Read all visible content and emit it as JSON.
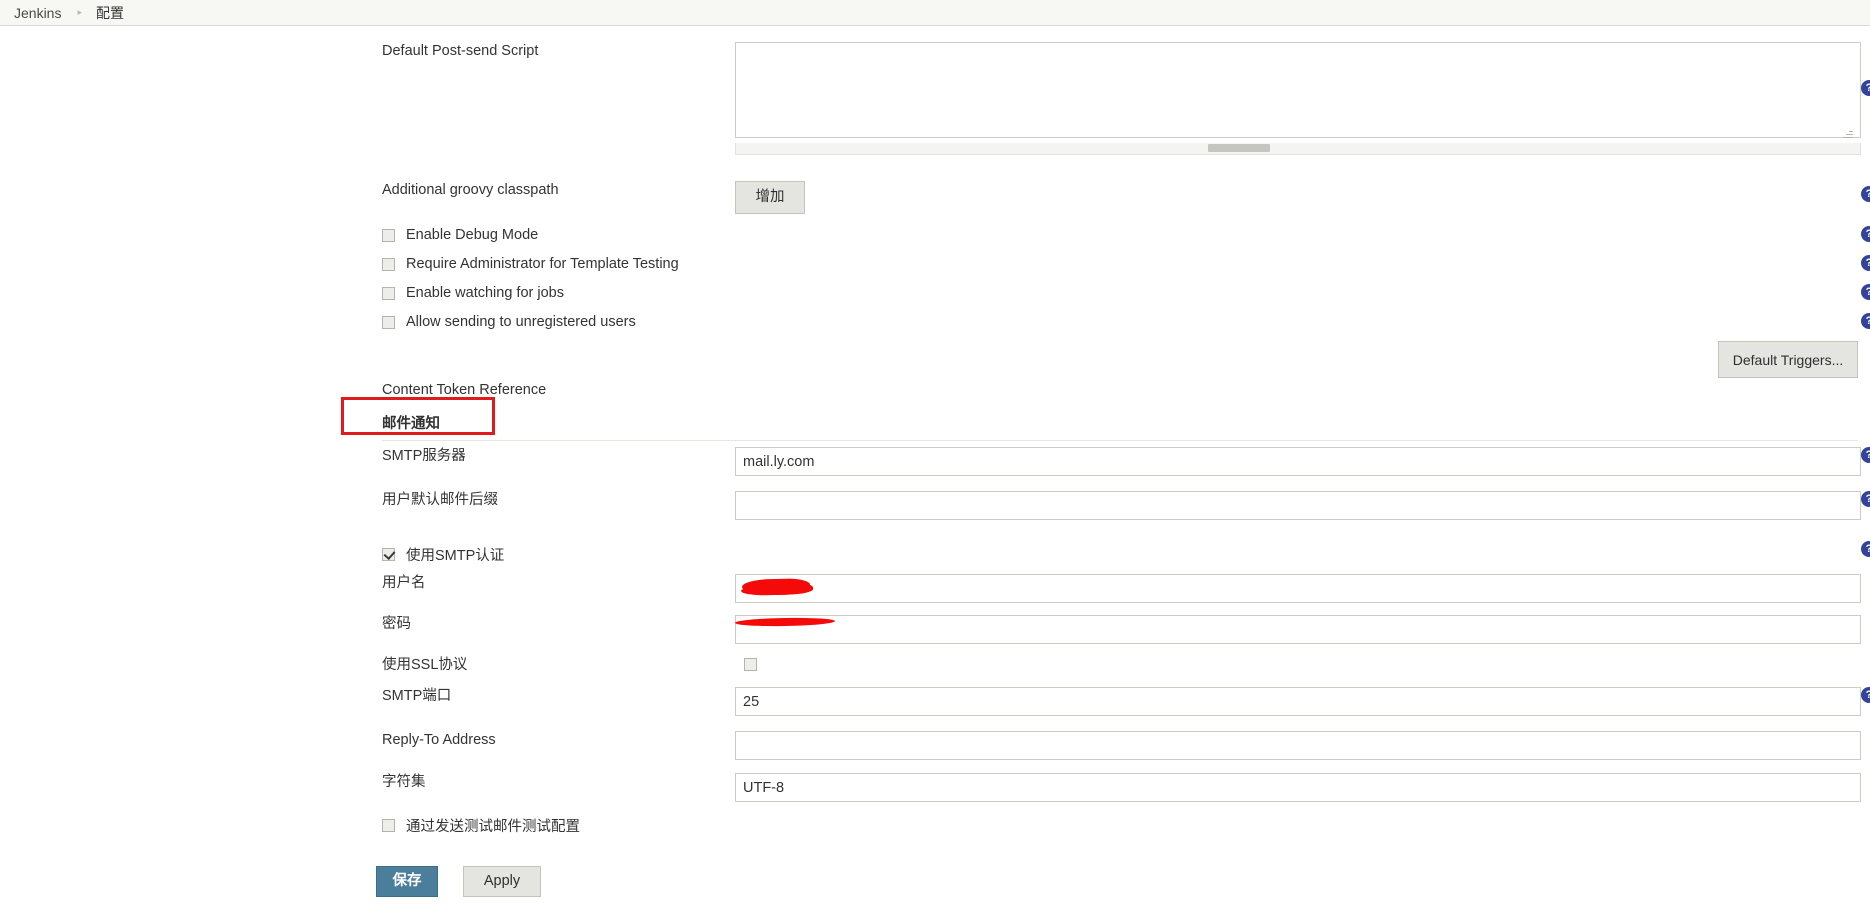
{
  "breadcrumb": {
    "root": "Jenkins",
    "separator": "▸",
    "current": "配置"
  },
  "extended_email": {
    "post_send_script": {
      "label": "Default Post-send Script",
      "value": ""
    },
    "groovy_classpath": {
      "label": "Additional groovy classpath",
      "add_button": "增加"
    },
    "checkboxes": [
      {
        "label": "Enable Debug Mode",
        "checked": false
      },
      {
        "label": "Require Administrator for Template Testing",
        "checked": false
      },
      {
        "label": "Enable watching for jobs",
        "checked": false
      },
      {
        "label": "Allow sending to unregistered users",
        "checked": false
      }
    ],
    "default_triggers_button": "Default Triggers...",
    "content_token_reference": "Content Token Reference"
  },
  "mailer": {
    "section_title": "邮件通知",
    "annotation_color": "#e01b1b",
    "fields": {
      "smtp_server": {
        "label": "SMTP服务器",
        "value": "mail.ly.com"
      },
      "default_suffix": {
        "label": "用户默认邮件后缀",
        "value": ""
      },
      "use_smtp_auth": {
        "label": "使用SMTP认证",
        "checked": true
      },
      "username": {
        "label": "用户名",
        "value": "",
        "redacted": true
      },
      "password": {
        "label": "密码",
        "value": "",
        "redacted": true
      },
      "use_ssl": {
        "label": "使用SSL协议",
        "checked": false
      },
      "smtp_port": {
        "label": "SMTP端口",
        "value": "25"
      },
      "reply_to": {
        "label": "Reply-To Address",
        "value": ""
      },
      "charset": {
        "label": "字符集",
        "value": "UTF-8"
      },
      "test_config": {
        "label": "通过发送测试邮件测试配置",
        "checked": false
      }
    }
  },
  "footer": {
    "save_label": "保存",
    "apply_label": "Apply",
    "save_color": "#4b7e9b"
  },
  "help_icon_glyph": "?"
}
